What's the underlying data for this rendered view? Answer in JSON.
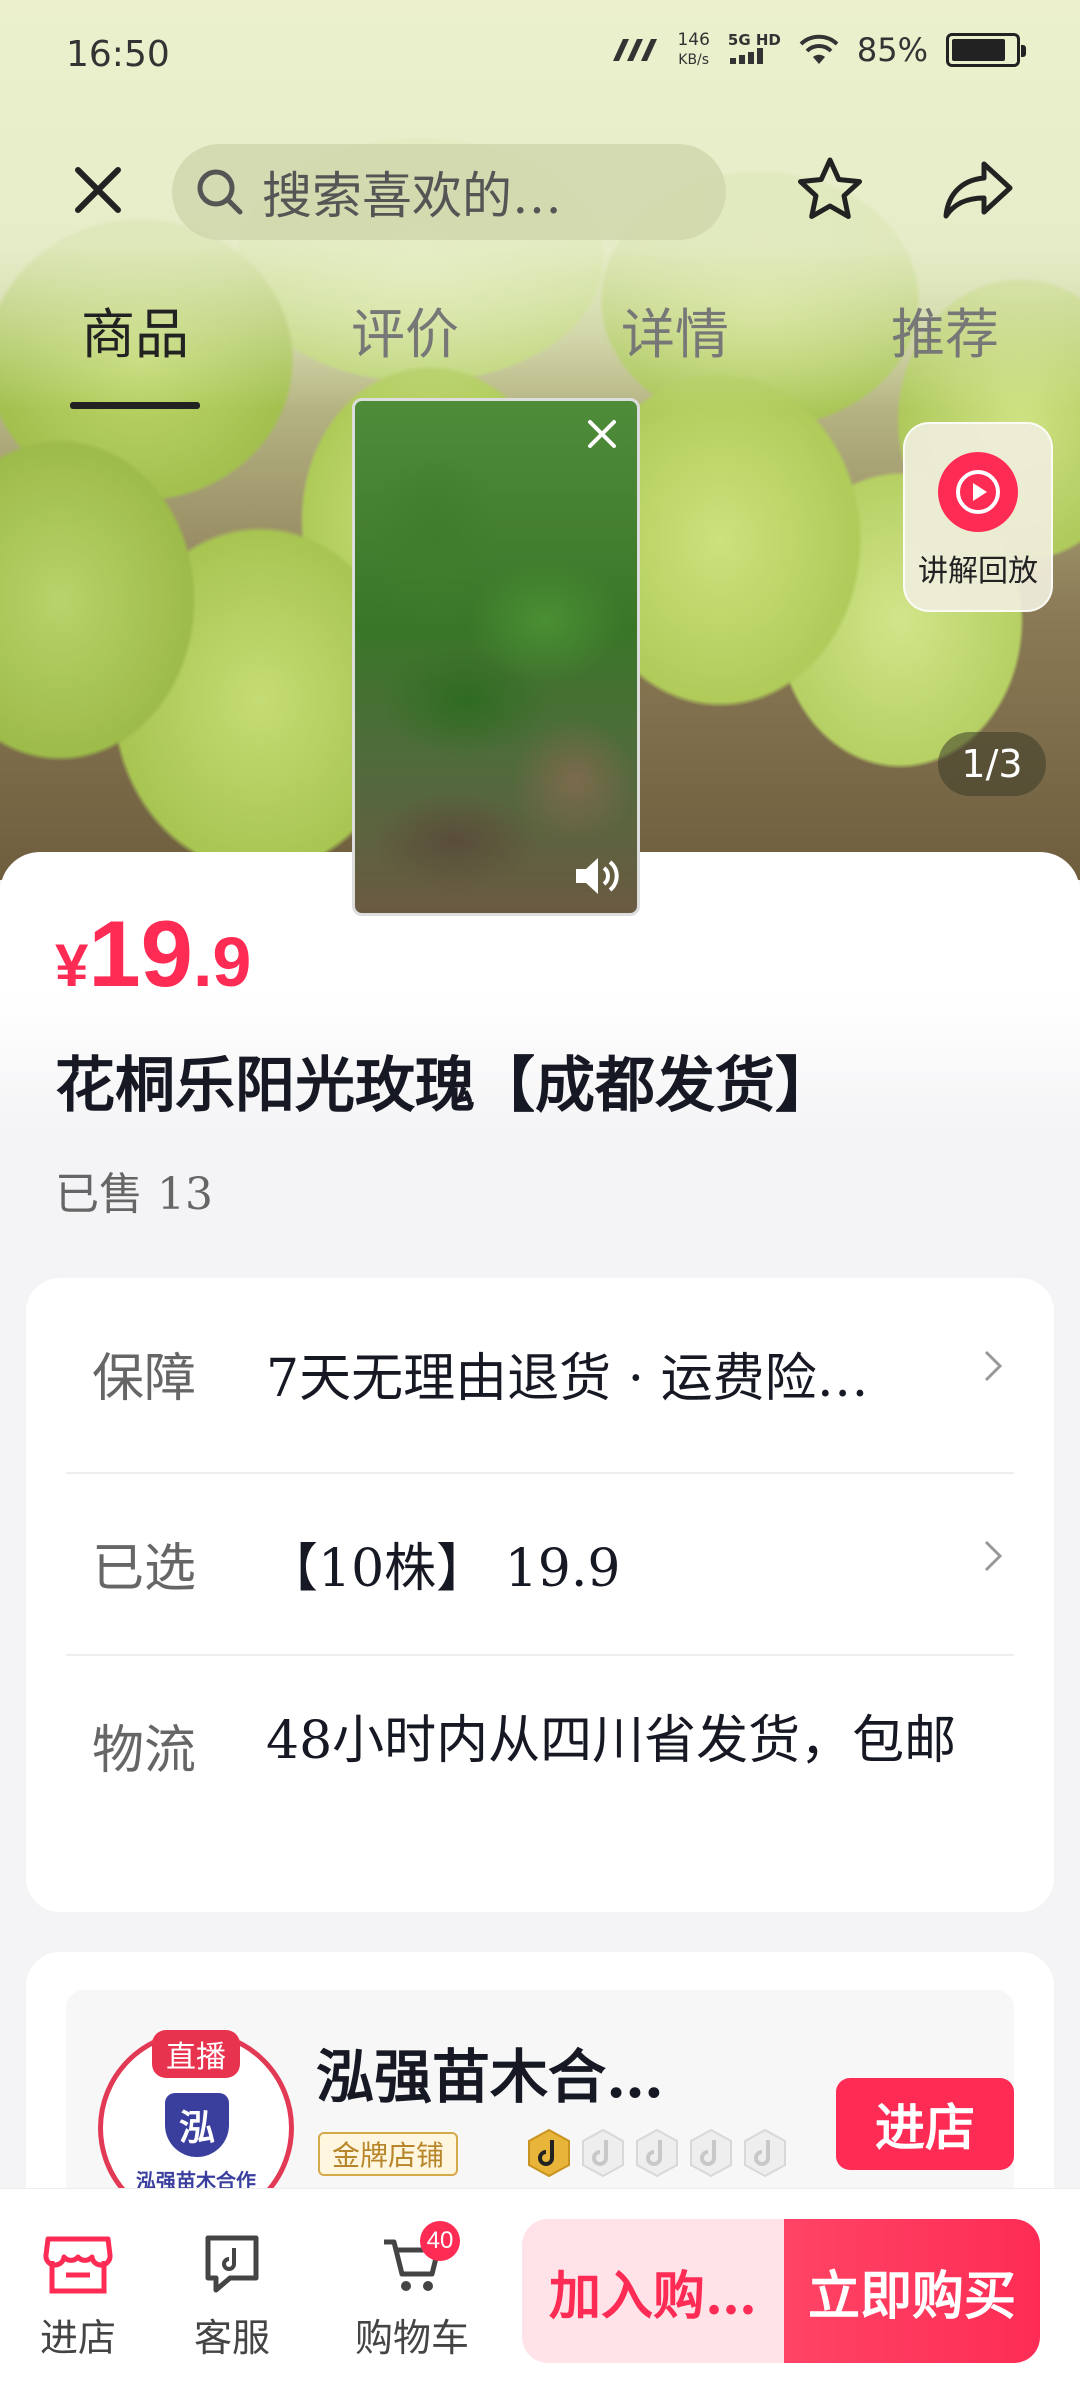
{
  "status_bar": {
    "time": "16:50",
    "net_speed_value": "146",
    "net_speed_unit": "KB/s",
    "signal_label": "5G HD",
    "battery_percent_text": "85%",
    "battery_level": 0.85
  },
  "header": {
    "search_placeholder": "搜索喜欢的…"
  },
  "tabs": [
    {
      "label": "商品",
      "active": true
    },
    {
      "label": "评价",
      "active": false
    },
    {
      "label": "详情",
      "active": false
    },
    {
      "label": "推荐",
      "active": false
    }
  ],
  "media": {
    "replay_label": "讲解回放",
    "page_indicator": "1/3"
  },
  "product": {
    "currency": "¥",
    "price_int": "19",
    "price_dec": ".9",
    "title": "花桐乐阳光玫瑰【成都发货】",
    "sold": "已售 13"
  },
  "info": [
    {
      "label": "保障",
      "value": "7天无理由退货 · 运费险…",
      "has_arrow": true
    },
    {
      "label": "已选",
      "value": "【10株】 19.9",
      "has_arrow": true
    },
    {
      "label": "物流",
      "value": "48小时内从四川省发货，包邮",
      "has_arrow": false
    }
  ],
  "shop": {
    "live_tag": "直播",
    "avatar_logo": "泓",
    "avatar_caption": "泓强苗木合作",
    "name": "泓强苗木合…",
    "badge": "金牌店铺",
    "enter_label": "进店"
  },
  "bottom_bar": {
    "items": [
      {
        "label": "进店",
        "icon": "store-icon"
      },
      {
        "label": "客服",
        "icon": "customer-service-icon"
      },
      {
        "label": "购物车",
        "icon": "cart-icon",
        "badge": "40"
      }
    ],
    "add_to_cart": "加入购…",
    "buy_now": "立即购买"
  },
  "colors": {
    "accent": "#fe2c55",
    "gold": "#d4a94a"
  }
}
